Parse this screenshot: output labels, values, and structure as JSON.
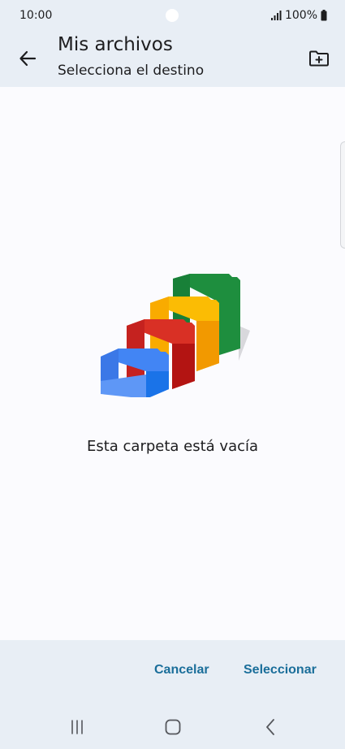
{
  "status_bar": {
    "time": "10:00",
    "battery": "100%",
    "icons": [
      "signal-icon",
      "battery-icon"
    ]
  },
  "header": {
    "title": "Mis archivos",
    "subtitle": "Selecciona el destino",
    "back_icon": "arrow-left-icon",
    "new_folder_icon": "folder-plus-icon"
  },
  "content": {
    "empty_message": "Esta carpeta está vacía",
    "illustration": "empty-folders-illustration"
  },
  "actions": {
    "cancel_label": "Cancelar",
    "select_label": "Seleccionar"
  },
  "nav": {
    "icons": [
      "recents-icon",
      "home-icon",
      "back-icon"
    ]
  },
  "colors": {
    "bar_background": "#e8eef5",
    "content_background": "#fbfbfe",
    "accent": "#1a6e9a"
  }
}
